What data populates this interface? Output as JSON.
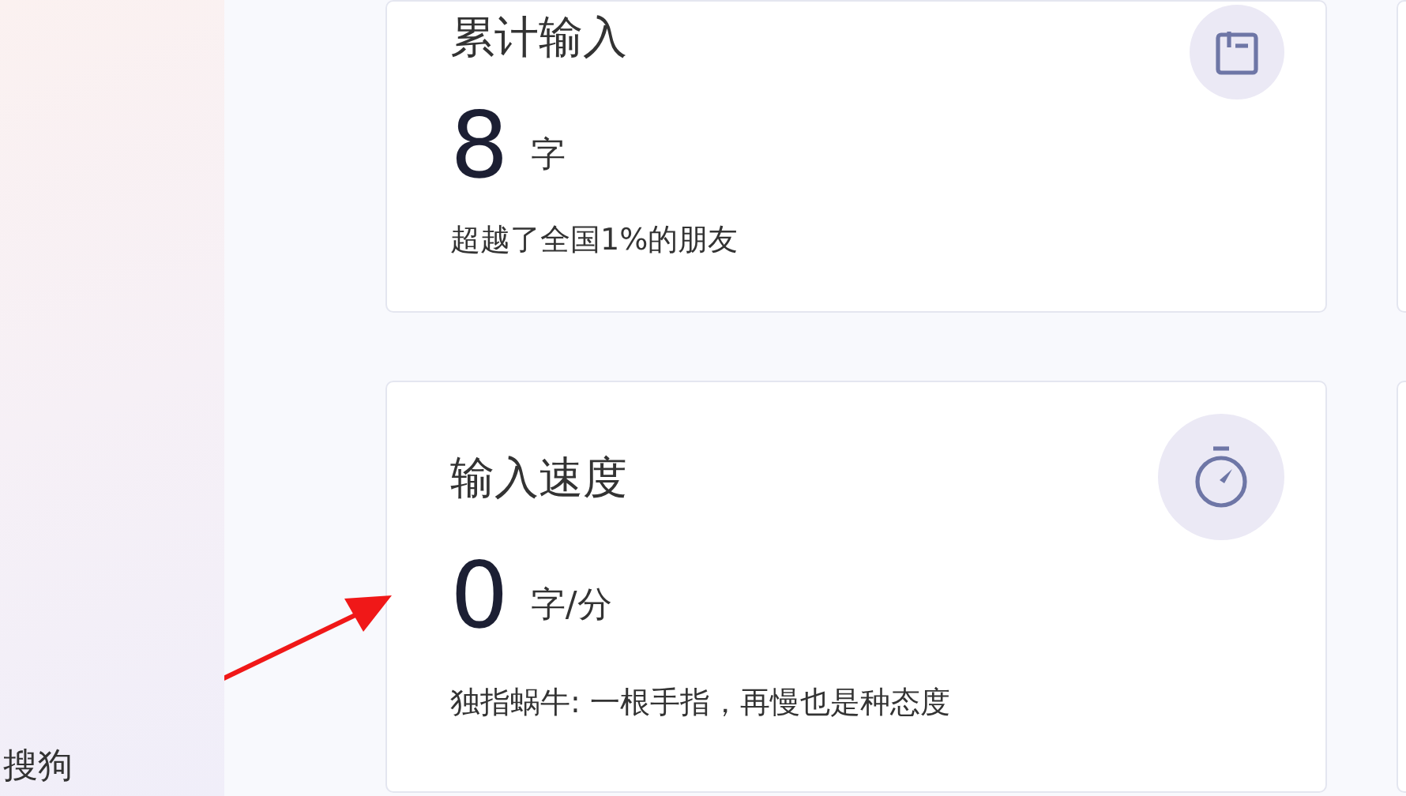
{
  "sidebar": {
    "brand": "搜狗"
  },
  "cards": [
    {
      "kind": "clipboard",
      "title": "累计输入",
      "value": "8",
      "unit": "字",
      "note": "超越了全国1%的朋友"
    },
    {
      "kind": "stopwatch",
      "title": "输入速度",
      "value": "0",
      "unit": "字/分",
      "note": "独指蜗牛: 一根手指，再慢也是种态度"
    }
  ]
}
